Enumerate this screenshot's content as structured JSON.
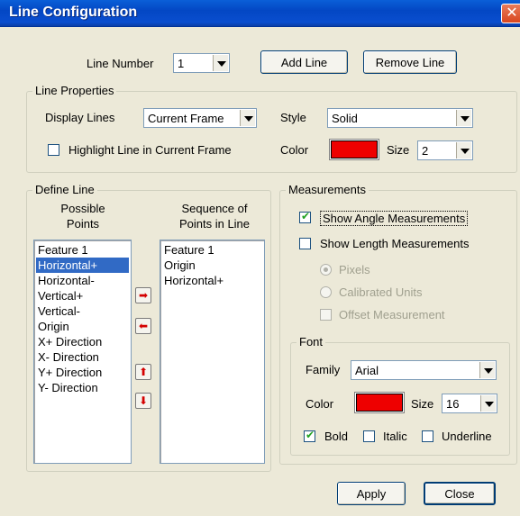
{
  "window": {
    "title": "Line Configuration",
    "close_glyph": "✕"
  },
  "top": {
    "line_number_label": "Line Number",
    "line_number_value": "1",
    "add_line": "Add Line",
    "remove_line": "Remove Line"
  },
  "line_properties": {
    "legend": "Line Properties",
    "display_lines_label": "Display Lines",
    "display_lines_value": "Current Frame",
    "style_label": "Style",
    "style_value": "Solid",
    "highlight_label": "Highlight Line in Current Frame",
    "highlight_checked": false,
    "color_label": "Color",
    "color_value": "#ee0000",
    "size_label": "Size",
    "size_value": "2"
  },
  "define_line": {
    "legend": "Define Line",
    "possible_header_1": "Possible",
    "possible_header_2": "Points",
    "sequence_header_1": "Sequence of",
    "sequence_header_2": "Points in Line",
    "possible_points": [
      "Feature 1",
      "Horizontal+",
      "Horizontal-",
      "Vertical+",
      "Vertical-",
      "Origin",
      "X+ Direction",
      "X- Direction",
      "Y+ Direction",
      "Y- Direction"
    ],
    "selected_possible": "Horizontal+",
    "sequence_points": [
      "Feature 1",
      "Origin",
      "Horizontal+"
    ],
    "buttons": {
      "add_icon": "arrow-right-icon",
      "remove_icon": "arrow-left-icon",
      "up_icon": "arrow-up-icon",
      "down_icon": "arrow-down-icon",
      "add_glyph": "➡",
      "remove_glyph": "⬅",
      "up_glyph": "⬆",
      "down_glyph": "⬇"
    }
  },
  "measurements": {
    "legend": "Measurements",
    "show_angle_label": "Show Angle Measurements",
    "show_angle_checked": true,
    "show_length_label": "Show Length Measurements",
    "show_length_checked": false,
    "pixels_label": "Pixels",
    "calibrated_label": "Calibrated Units",
    "offset_label": "Offset Measurement",
    "font": {
      "legend": "Font",
      "family_label": "Family",
      "family_value": "Arial",
      "color_label": "Color",
      "color_value": "#ee0000",
      "size_label": "Size",
      "size_value": "16",
      "bold_label": "Bold",
      "bold_checked": true,
      "italic_label": "Italic",
      "italic_checked": false,
      "underline_label": "Underline",
      "underline_checked": false
    }
  },
  "footer": {
    "apply": "Apply",
    "close": "Close"
  }
}
